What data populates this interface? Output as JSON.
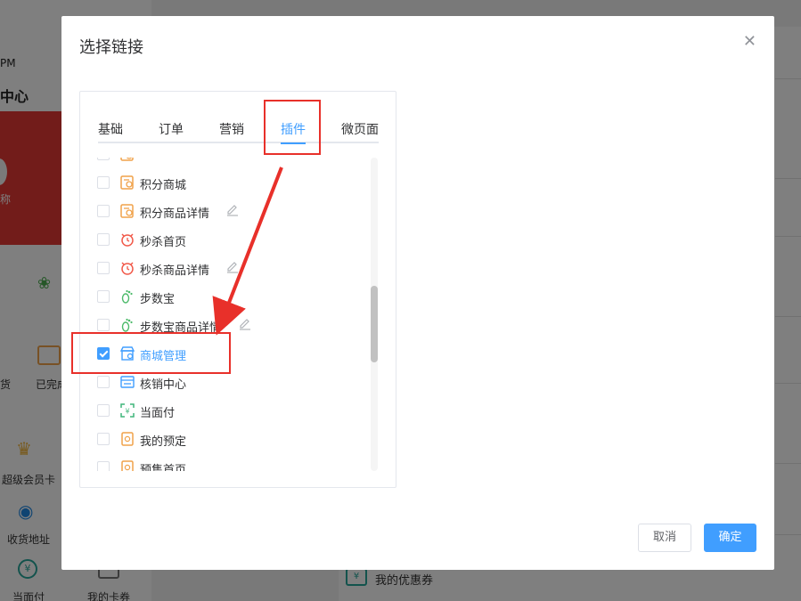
{
  "background": {
    "time_fragment": "PM",
    "center_fragment": "中心",
    "nickname_fragment": "称",
    "order_fragment": "货",
    "done_label": "已完成",
    "vip_label": "超级会员卡",
    "address_label": "收货地址",
    "pay_label": "当面付",
    "card_label": "我的卡券",
    "coupon_label": "我的优惠券"
  },
  "dialog": {
    "title": "选择链接",
    "tabs": [
      {
        "label": "基础",
        "active": false
      },
      {
        "label": "订单",
        "active": false
      },
      {
        "label": "营销",
        "active": false
      },
      {
        "label": "插件",
        "active": true
      },
      {
        "label": "微页面",
        "active": false
      }
    ],
    "items": [
      {
        "label": "积分商城",
        "icon": "points-mall-icon",
        "color": "#f0a24a",
        "checked": false,
        "editable": false
      },
      {
        "label": "积分商品详情",
        "icon": "points-mall-icon",
        "color": "#f0a24a",
        "checked": false,
        "editable": true
      },
      {
        "label": "秒杀首页",
        "icon": "alarm-clock-icon",
        "color": "#f15a4a",
        "checked": false,
        "editable": false
      },
      {
        "label": "秒杀商品详情",
        "icon": "alarm-clock-icon",
        "color": "#f15a4a",
        "checked": false,
        "editable": true
      },
      {
        "label": "步数宝",
        "icon": "footprint-icon",
        "color": "#4cba6a",
        "checked": false,
        "editable": false
      },
      {
        "label": "步数宝商品详情",
        "icon": "footprint-icon",
        "color": "#4cba6a",
        "checked": false,
        "editable": true
      },
      {
        "label": "商城管理",
        "icon": "store-manage-icon",
        "color": "#409eff",
        "checked": true,
        "editable": false
      },
      {
        "label": "核销中心",
        "icon": "verify-center-icon",
        "color": "#409eff",
        "checked": false,
        "editable": false
      },
      {
        "label": "当面付",
        "icon": "scan-pay-icon",
        "color": "#3fb57a",
        "checked": false,
        "editable": false
      },
      {
        "label": "我的预定",
        "icon": "booking-icon",
        "color": "#f0a24a",
        "checked": false,
        "editable": false
      },
      {
        "label": "预售首页",
        "icon": "booking-icon",
        "color": "#f0a24a",
        "checked": false,
        "editable": false
      }
    ],
    "cancel_label": "取消",
    "ok_label": "确定"
  },
  "colors": {
    "primary": "#409eff",
    "annotation_red": "#e8302a",
    "overlay": "rgba(0,0,0,0.5)"
  }
}
